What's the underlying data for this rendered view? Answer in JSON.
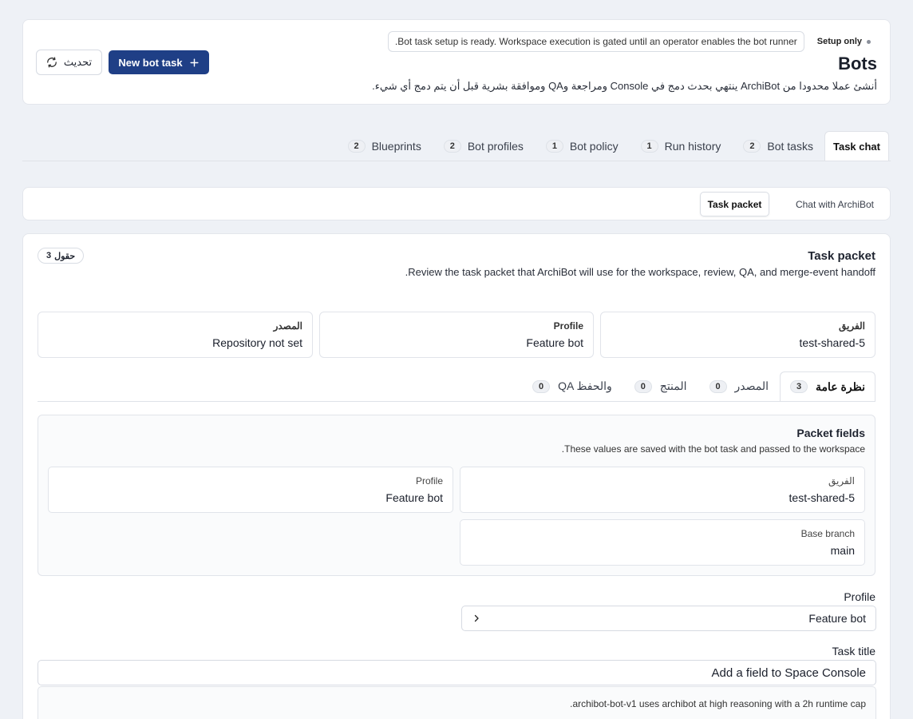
{
  "header": {
    "setup_only": "Setup only",
    "notice": "Bot task setup is ready. Workspace execution is gated until an operator enables the bot runner.",
    "title": "Bots",
    "description": "أنشئ عملا محدودا من ArchiBot ينتهي بحدث دمج في Console ومراجعة وQA وموافقة بشرية قبل أن يتم دمج أي شيء.",
    "refresh_label": "تحديث",
    "new_task_label": "New bot task"
  },
  "tabs": [
    {
      "label": "Task chat",
      "count": null
    },
    {
      "label": "Bot tasks",
      "count": "2"
    },
    {
      "label": "Run history",
      "count": "1"
    },
    {
      "label": "Bot policy",
      "count": "1"
    },
    {
      "label": "Bot profiles",
      "count": "2"
    },
    {
      "label": "Blueprints",
      "count": "2"
    }
  ],
  "sub_toggle": {
    "chat": "Chat with ArchiBot",
    "packet": "Task packet"
  },
  "packet": {
    "title": "Task packet",
    "description": "Review the task packet that ArchiBot will use for the workspace, review, QA, and merge-event handoff.",
    "fields_count": "3",
    "fields_word": "حقول",
    "info": [
      {
        "label": "الفريق",
        "value": "test-shared-5"
      },
      {
        "label": "Profile",
        "value": "Feature bot"
      },
      {
        "label": "المصدر",
        "value": "Repository not set"
      }
    ],
    "inner_tabs": [
      {
        "label": "نظرة عامة",
        "count": "3"
      },
      {
        "label": "المصدر",
        "count": "0"
      },
      {
        "label": "المنتج",
        "count": "0"
      },
      {
        "label": "QA والحفظ",
        "count": "0"
      }
    ],
    "fields_panel": {
      "title": "Packet fields",
      "description": "These values are saved with the bot task and passed to the workspace.",
      "fields": [
        {
          "label": "الفريق",
          "value": "test-shared-5"
        },
        {
          "label": "Profile",
          "value": "Feature bot"
        },
        {
          "label": "Base branch",
          "value": "main"
        }
      ]
    },
    "profile_label": "Profile",
    "profile_value": "Feature bot",
    "task_title_label": "Task title",
    "task_title_value": "Add a field to Space Console",
    "runtime_note": "archibot-bot-v1 uses archibot at high reasoning with a 2h runtime cap."
  },
  "colors": {
    "primary": "#1f3f86",
    "background": "#eef1f6"
  }
}
